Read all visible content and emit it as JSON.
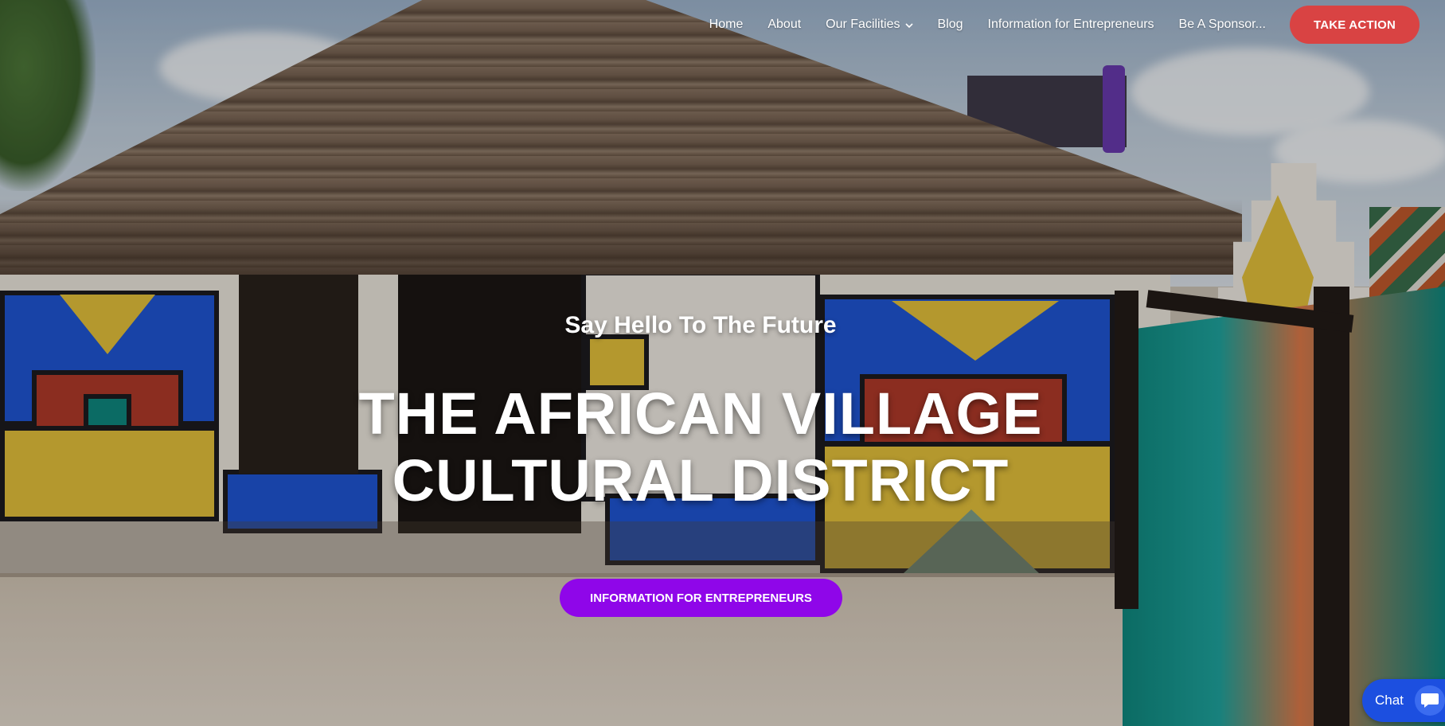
{
  "nav": {
    "items": [
      {
        "label": "Home"
      },
      {
        "label": "About"
      },
      {
        "label": "Our Facilities",
        "has_dropdown": true
      },
      {
        "label": "Blog"
      },
      {
        "label": "Information for Entrepreneurs"
      },
      {
        "label": "Be A Sponsor..."
      }
    ],
    "cta_label": "TAKE ACTION"
  },
  "hero": {
    "eyebrow": "Say Hello To The Future",
    "headline_line1": "THE AFRICAN VILLAGE",
    "headline_line2": "CULTURAL DISTRICT",
    "button_label": "INFORMATION FOR ENTREPRENEURS"
  },
  "chat": {
    "label": "Chat",
    "icon": "chat-bubble-icon"
  },
  "colors": {
    "cta": "#d94343",
    "primary_button": "#8f06e9",
    "chat": "#1c4fe0"
  }
}
